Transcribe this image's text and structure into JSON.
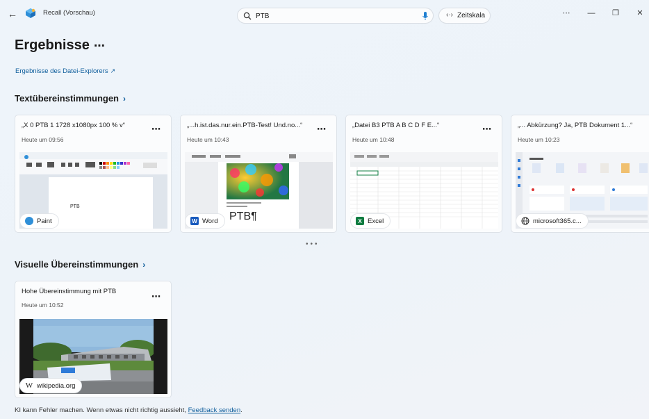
{
  "window": {
    "app_title": "Recall (Vorschau)",
    "more_label": "⋯",
    "minimize_label": "—",
    "maximize_label": "❐",
    "close_label": "✕"
  },
  "search": {
    "value": "PTB",
    "placeholder": ""
  },
  "timeline_button": {
    "label": "Zeitskala"
  },
  "header": {
    "title": "Ergebnisse",
    "more_label": "⋯",
    "explorer_link": "Ergebnisse des Datei-Explorers"
  },
  "text_matches": {
    "title": "Textübereinstimmungen",
    "cards": [
      {
        "title": "„X 0 PTB 1 1728 x1080px 100 % v“",
        "time": "Heute um 09:56",
        "app": "Paint",
        "more": "⋯"
      },
      {
        "title": "„...h.ist.das.nur.ein.PTB-Test! Und.no...“",
        "time": "Heute um 10:43",
        "app": "Word",
        "more": "⋯"
      },
      {
        "title": "„Datei B3 PTB A B C D F E...“",
        "time": "Heute um 10:48",
        "app": "Excel",
        "more": "⋯"
      },
      {
        "title": "„... Abkürzung? Ja, PTB Dokument 1...“",
        "time": "Heute um 10:23",
        "app": "microsoft365.c...",
        "more": "⋯"
      }
    ],
    "pager": "•••",
    "paint_thumb_text": "PTB",
    "word_thumb_text": "PTB¶"
  },
  "visual_matches": {
    "title": "Visuelle Übereinstimmungen",
    "cards": [
      {
        "title": "Hohe Übereinstimmung mit PTB",
        "time": "Heute um 10:52",
        "app": "wikipedia.org",
        "more": "⋯"
      }
    ]
  },
  "footer": {
    "disclaimer": "KI kann Fehler machen. Wenn etwas nicht richtig aussieht, ",
    "feedback_link": "Feedback senden",
    "period": "."
  },
  "colors": {
    "accent": "#0f5e9c",
    "word": "#185abd",
    "excel": "#107c41"
  }
}
